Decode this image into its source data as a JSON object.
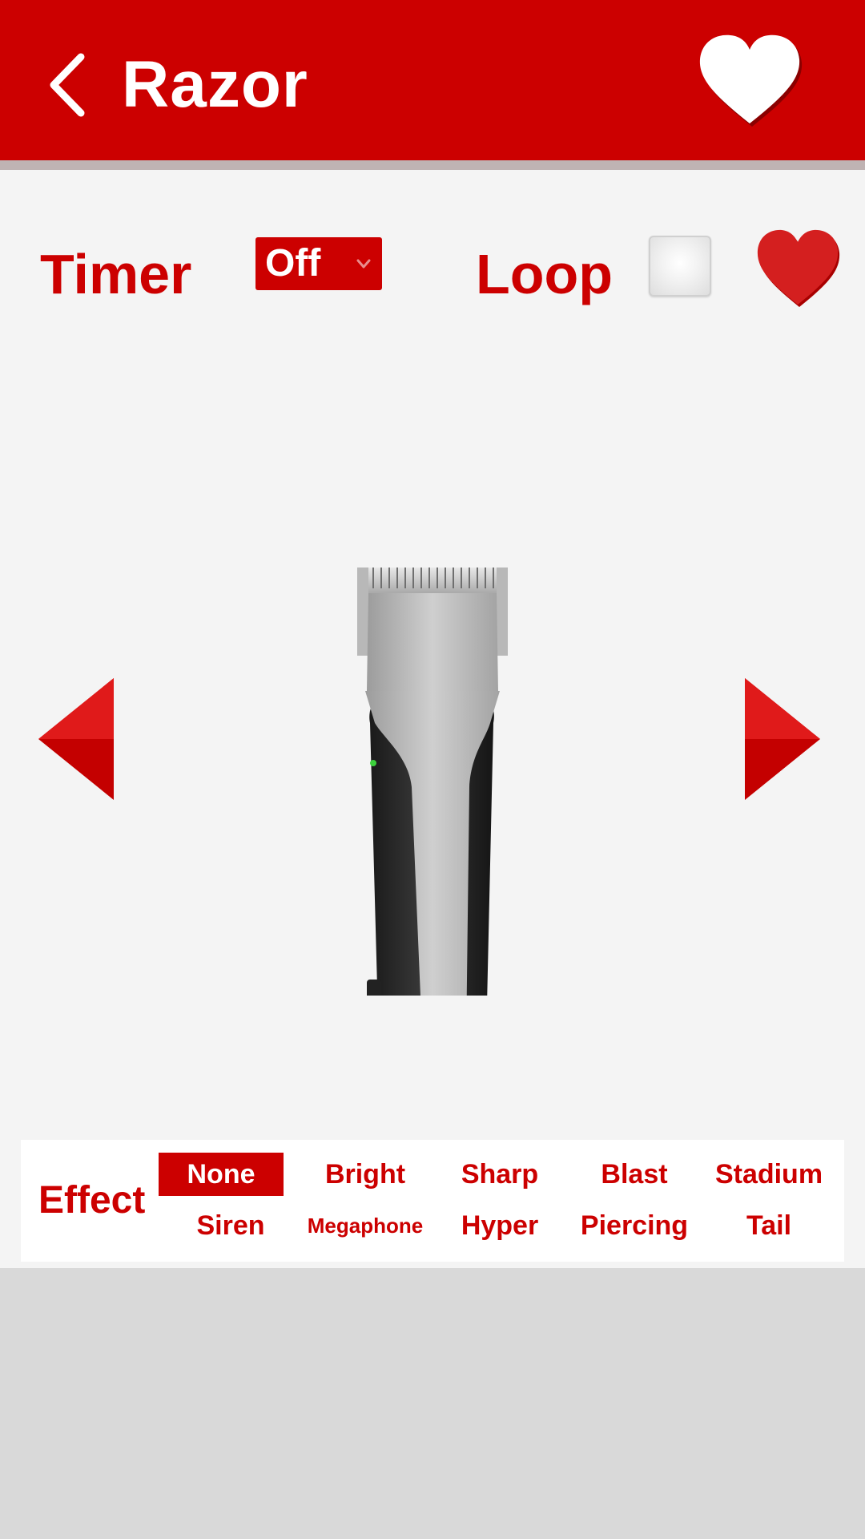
{
  "header": {
    "title": "Razor",
    "back_icon": "chevron-left-icon",
    "favorite_icon": "heart-icon"
  },
  "controls": {
    "timer_label": "Timer",
    "timer_value": "Off",
    "loop_label": "Loop",
    "loop_checked": false,
    "favorite_icon": "heart-icon"
  },
  "sound": {
    "image": "hair-clipper"
  },
  "nav": {
    "prev_icon": "triangle-left-icon",
    "next_icon": "triangle-right-icon"
  },
  "effects": {
    "label": "Effect",
    "selected": "None",
    "items": [
      {
        "label": "None"
      },
      {
        "label": "Bright"
      },
      {
        "label": "Sharp"
      },
      {
        "label": "Blast"
      },
      {
        "label": "Stadium"
      },
      {
        "label": "Siren"
      },
      {
        "label": "Megaphone"
      },
      {
        "label": "Hyper"
      },
      {
        "label": "Piercing"
      },
      {
        "label": "Tail"
      }
    ]
  },
  "colors": {
    "accent": "#cc0000",
    "background": "#f4f4f4",
    "footer": "#d9d9d9"
  }
}
